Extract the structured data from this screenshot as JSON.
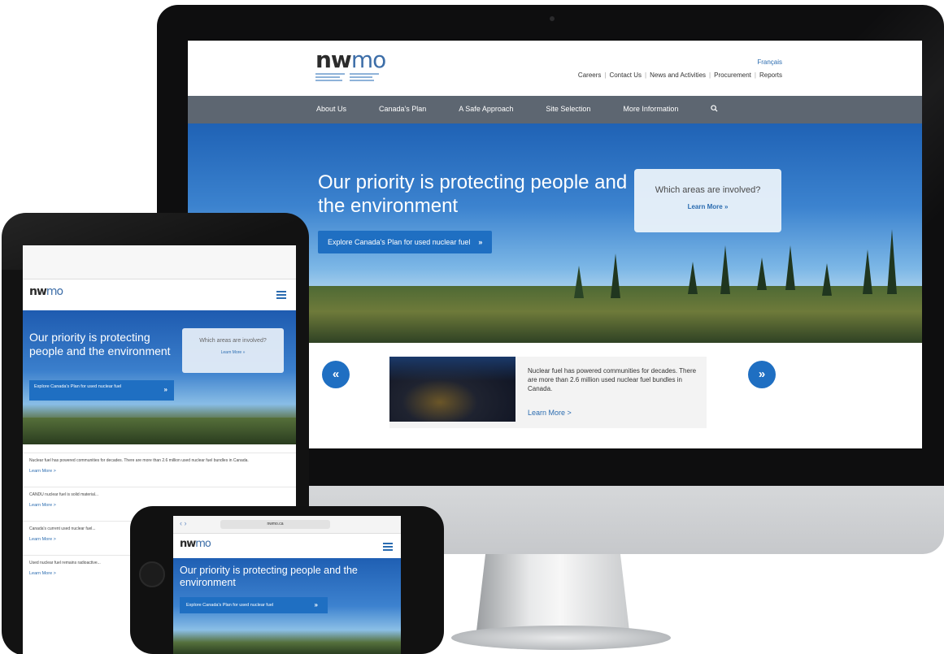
{
  "brand": {
    "logo_text": "nwmo",
    "accent": "#1f6fc2",
    "nav_bg": "#5d6671",
    "sky_blue": "#3c83cf"
  },
  "desktop": {
    "lang_link": "Français",
    "top_links": [
      "Careers",
      "Contact Us",
      "News and Activities",
      "Procurement",
      "Reports"
    ],
    "nav": [
      "About Us",
      "Canada's Plan",
      "A Safe Approach",
      "Site Selection",
      "More Information"
    ],
    "nav_search_icon": "search-icon",
    "hero_title": "Our priority is protecting people and the environment",
    "hero_cta": "Explore Canada's Plan for used nuclear fuel",
    "panel_question": "Which areas are involved?",
    "panel_link": "Learn More »",
    "card_text": "Nuclear fuel has powered communities for decades. There are more than 2.6 million used nuclear fuel bundles in Canada.",
    "card_link": "Learn More >",
    "prev_icon": "double-chevron-left-icon",
    "next_icon": "double-chevron-right-icon"
  },
  "tablet": {
    "hero_title": "Our priority is protecting people and the environment",
    "panel_question": "Which areas are involved?",
    "panel_link": "Learn More »",
    "hero_cta": "Explore Canada's Plan for used nuclear fuel",
    "blocks": [
      {
        "text": "Nuclear fuel has powered communities for decades. There are more than 2.6 million used nuclear fuel bundles in Canada.",
        "link": "Learn More >"
      },
      {
        "text": "CANDU nuclear fuel is solid material...",
        "link": "Learn More >"
      },
      {
        "text": "Canada's current used nuclear fuel...",
        "link": "Learn More >"
      },
      {
        "text": "Used nuclear fuel remains radioactive...",
        "link": "Learn More >"
      }
    ]
  },
  "phone": {
    "url": "nwmo.ca",
    "hero_title": "Our priority is protecting people and the environment",
    "hero_cta": "Explore Canada's Plan for used nuclear fuel"
  }
}
